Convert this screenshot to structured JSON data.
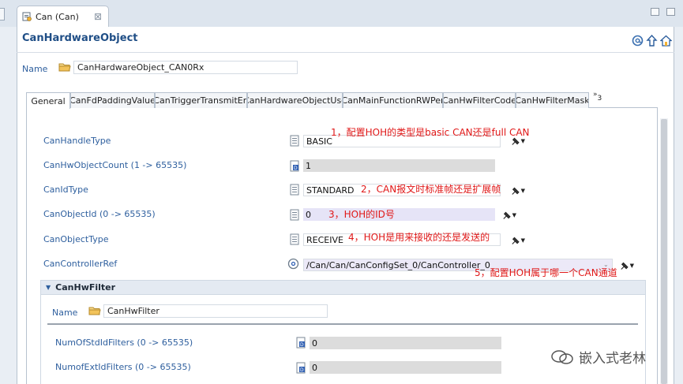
{
  "editor_tab": {
    "label": "Can (Can)",
    "close": "⊠"
  },
  "form": {
    "title": "CanHardwareObject"
  },
  "name_row": {
    "label": "Name",
    "value": "CanHardwareObject_CAN0Rx"
  },
  "tabs": [
    {
      "label": "General"
    },
    {
      "label": "CanFdPaddingValue"
    },
    {
      "label": "CanTriggerTransmitEn"
    },
    {
      "label": "CanHardwareObjectUse"
    },
    {
      "label": "CanMainFunctionRWPer"
    },
    {
      "label": "CanHwFilterCode"
    },
    {
      "label": "CanHwFilterMask"
    }
  ],
  "tabs_more": {
    "glyph": "»",
    "count": "3"
  },
  "params": [
    {
      "label": "CanHandleType",
      "value": "BASIC",
      "note": "1，配置HOH的类型是basic CAN还是full CAN"
    },
    {
      "label": "CanHwObjectCount (1 -> 65535)",
      "value": "1"
    },
    {
      "label": "CanIdType",
      "value": "STANDARD",
      "note": "2，CAN报文时标准帧还是扩展帧"
    },
    {
      "label": "CanObjectId (0 -> 65535)",
      "value": "0",
      "note": "3，HOH的ID号"
    },
    {
      "label": "CanObjectType",
      "value": "RECEIVE",
      "note": "4，HOH是用来接收的还是发送的"
    },
    {
      "label": "CanControllerRef",
      "value": "/Can/Can/CanConfigSet_0/CanController_0",
      "note": "5，配置HOH属于哪一个CAN通道"
    }
  ],
  "filter_section": {
    "title": "CanHwFilter",
    "name_label": "Name",
    "name_value": "CanHwFilter",
    "params": [
      {
        "label": "NumOfStdIdFilters (0 -> 65535)",
        "value": "0"
      },
      {
        "label": "NumofExtIdFilters (0 -> 65535)",
        "value": "0"
      }
    ]
  },
  "watermark": {
    "text": "嵌入式老林"
  },
  "colors": {
    "label_blue": "#2e5f9e",
    "annotation_red": "#e01818",
    "title_blue": "#1f4e86"
  }
}
